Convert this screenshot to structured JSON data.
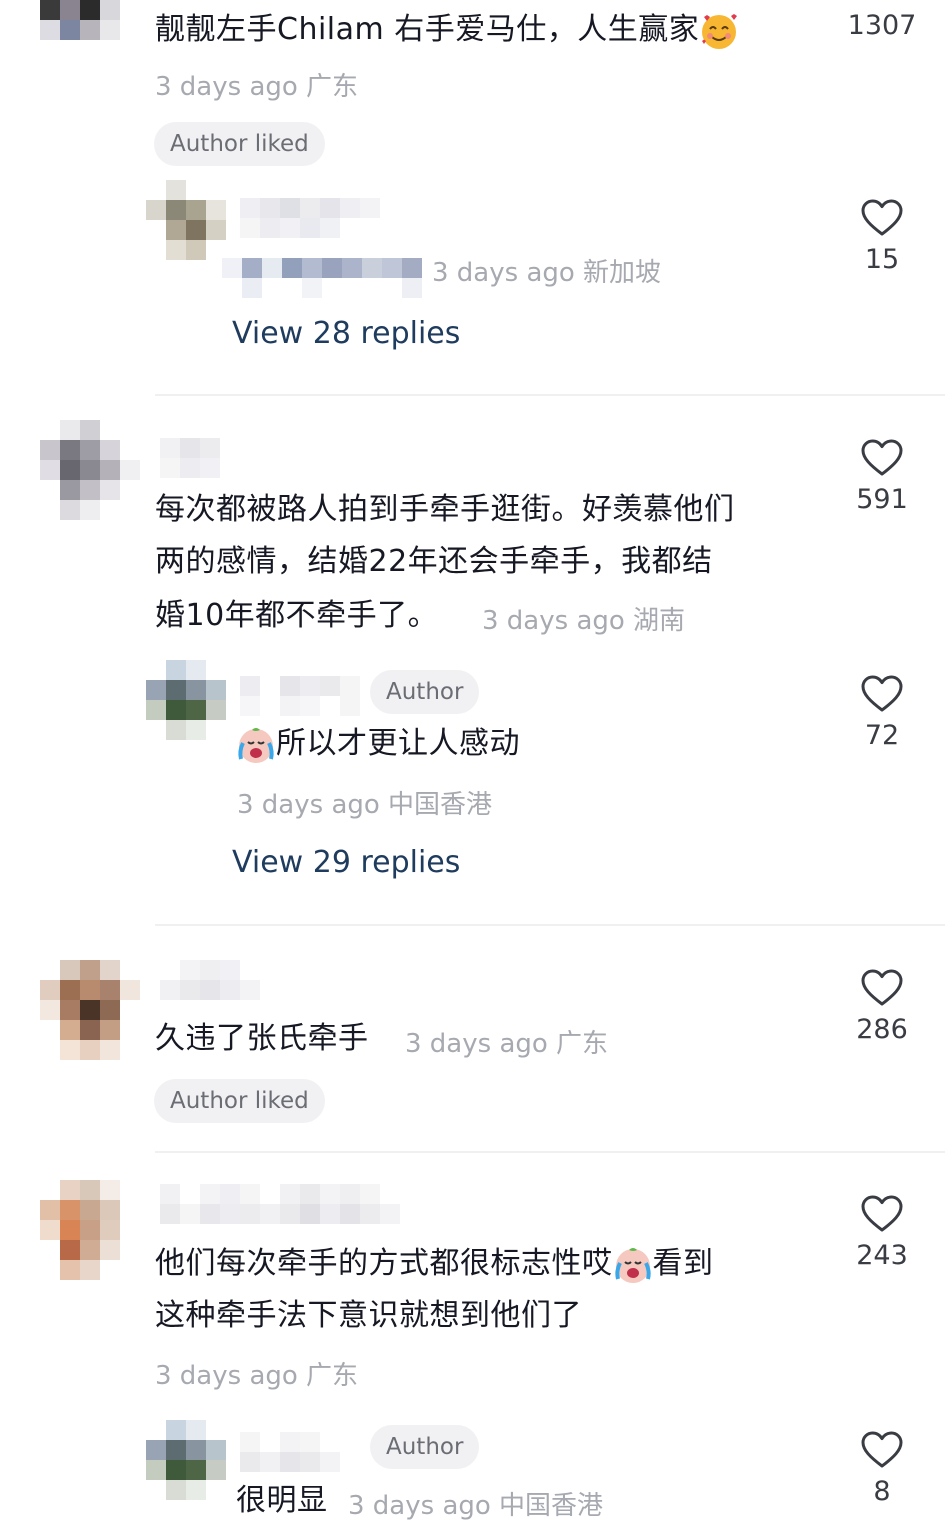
{
  "comments": [
    {
      "text": "靓靓左手Chilam 右手爱马仕，人生赢家",
      "meta": "3 days ago 广东",
      "likes": "1307",
      "badge": "Author liked",
      "reply": {
        "meta": "3 days ago 新加坡",
        "likes": "15"
      },
      "view_replies": "View 28 replies"
    },
    {
      "lines": [
        "每次都被路人拍到手牵手逛街。好羡慕他们",
        "两的感情，结婚22年还会手牵手，我都结",
        "婚10年都不牵手了。"
      ],
      "meta": "3 days ago 湖南",
      "likes": "591",
      "reply": {
        "author_tag": "Author",
        "text": "所以才更让人感动",
        "meta": "3 days ago 中国香港",
        "likes": "72"
      },
      "view_replies": "View 29 replies"
    },
    {
      "text": "久违了张氏牵手",
      "meta": "3 days ago 广东",
      "likes": "286",
      "badge": "Author liked"
    },
    {
      "lines": [
        "他们每次牵手的方式都很标志性哎",
        "看到",
        "这种牵手法下意识就想到他们了"
      ],
      "meta": "3 days ago 广东",
      "likes": "243",
      "reply": {
        "author_tag": "Author",
        "text": "很明显",
        "meta": "3 days ago 中国香港",
        "likes": "8"
      }
    }
  ],
  "icons": {
    "like": "heart-outline-icon",
    "emoji_smile": "smiling-face-with-hearts-emoji",
    "emoji_cry": "loudly-crying-face-emoji"
  },
  "colors": {
    "link": "#1f3c5e",
    "meta": "#a7a9b0",
    "chip_bg": "#f1f1f3"
  }
}
